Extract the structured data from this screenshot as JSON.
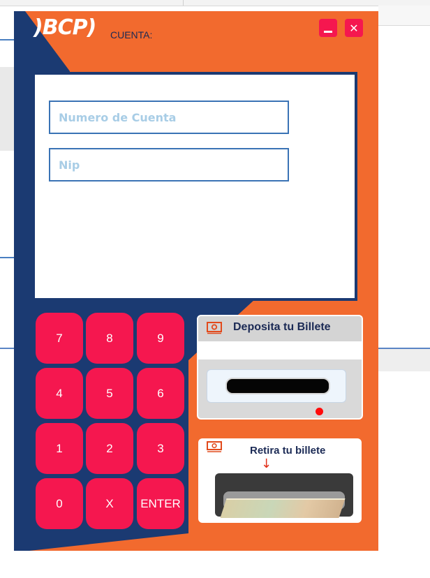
{
  "window": {
    "logo": ")BCP)",
    "cuenta_label": "CUENTA:",
    "minimize_label": "",
    "close_label": "✕"
  },
  "login": {
    "account_placeholder": "Numero de Cuenta",
    "account_value": "",
    "nip_placeholder": "Nip",
    "nip_value": ""
  },
  "keypad": {
    "keys": [
      "7",
      "8",
      "9",
      "4",
      "5",
      "6",
      "1",
      "2",
      "3",
      "0",
      "X",
      "ENTER"
    ]
  },
  "deposit": {
    "title": "Deposita tu Billete",
    "icon": "money-icon"
  },
  "withdraw": {
    "title": "Retira tu billete",
    "arrow": "↓",
    "icon": "money-icon"
  },
  "colors": {
    "orange": "#f26a2e",
    "navy": "#1b3a72",
    "key_pink": "#f5174f",
    "led_red": "#ff0b0b"
  }
}
